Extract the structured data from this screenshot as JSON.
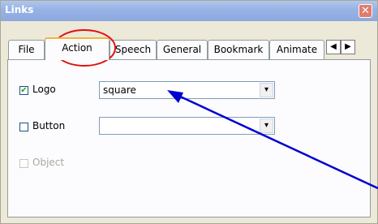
{
  "window": {
    "title": "Links",
    "close_symbol": "✕"
  },
  "tabs": [
    {
      "label": "File"
    },
    {
      "label": "Action"
    },
    {
      "label": "Speech"
    },
    {
      "label": "General"
    },
    {
      "label": "Bookmark"
    },
    {
      "label": "Animate"
    }
  ],
  "tab_scroll": {
    "left_symbol": "◀",
    "right_symbol": "▶"
  },
  "options": {
    "logo": {
      "label": "Logo",
      "checked_mark": "✔",
      "value": "square",
      "arrow": "▾"
    },
    "button": {
      "label": "Button",
      "value": "",
      "arrow": "▾"
    },
    "object": {
      "label": "Object"
    }
  },
  "annotation": {
    "circle_color": "#e01010",
    "arrow_color": "#0000d0"
  }
}
